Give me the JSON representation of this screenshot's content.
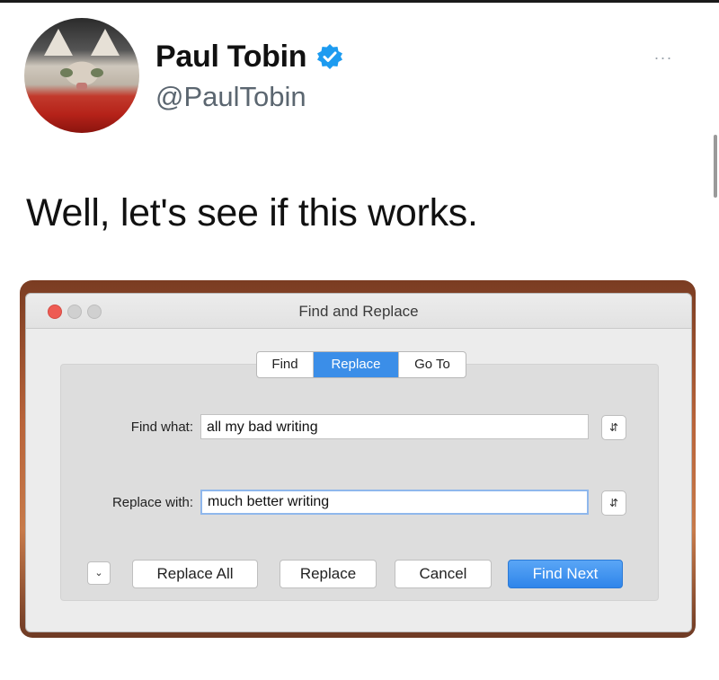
{
  "tweet": {
    "author_name": "Paul Tobin",
    "handle": "@PaulTobin",
    "more_label": "...",
    "text": "Well, let's see if this works."
  },
  "icons": {
    "verified": "verified-badge-icon",
    "avatar": "cat-avatar",
    "more": "more-icon",
    "stepper": "up-down-stepper-icon",
    "disclosure": "chevron-down-icon"
  },
  "colors": {
    "accent_blue": "#3b8ee8",
    "verified_blue": "#1d9bf0",
    "close_red": "#ee5b53"
  },
  "dialog": {
    "title": "Find and Replace",
    "tabs": [
      {
        "label": "Find",
        "selected": false
      },
      {
        "label": "Replace",
        "selected": true
      },
      {
        "label": "Go To",
        "selected": false
      }
    ],
    "find_what_label": "Find what:",
    "find_what_value": "all my bad writing",
    "replace_with_label": "Replace with:",
    "replace_with_value": "much better writing",
    "buttons": {
      "replace_all": "Replace All",
      "replace": "Replace",
      "cancel": "Cancel",
      "find_next": "Find Next"
    }
  }
}
